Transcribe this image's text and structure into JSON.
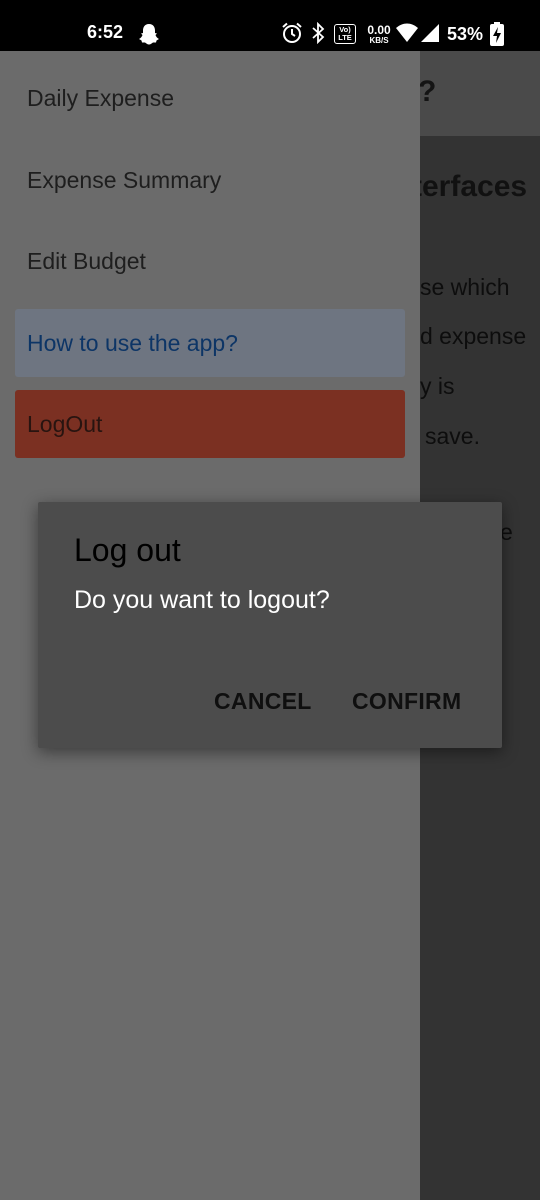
{
  "status_bar": {
    "time": "6:52",
    "volte_badge": "Vo) LTE",
    "net_speed_value": "0.00",
    "net_speed_unit": "KB/S",
    "battery_percent": "53%",
    "icons": [
      "snapchat-icon",
      "alarm-icon",
      "bluetooth-icon",
      "volte-icon",
      "wifi-icon",
      "signal-icon",
      "battery-charging-icon"
    ]
  },
  "background_page": {
    "title_fragment": "?",
    "subheading_fragment": "terfaces",
    "lines": [
      "se which",
      "d expense",
      "y is",
      "save.",
      "e"
    ]
  },
  "drawer": {
    "items": [
      {
        "label": "Daily Expense"
      },
      {
        "label": "Expense Summary"
      },
      {
        "label": "Edit Budget"
      },
      {
        "label": "How to use the app?"
      },
      {
        "label": "LogOut"
      }
    ]
  },
  "dialog": {
    "title": "Log out",
    "message": "Do you want to logout?",
    "cancel_label": "CANCEL",
    "confirm_label": "CONFIRM"
  },
  "colors": {
    "status_bar_bg": "#000000",
    "drawer_bg": "#6b6b6b",
    "selected_item_bg": "#6e7581",
    "selected_item_text": "#0d3566",
    "logout_bg": "#7b3022",
    "dialog_bg": "#4c4c4c"
  }
}
